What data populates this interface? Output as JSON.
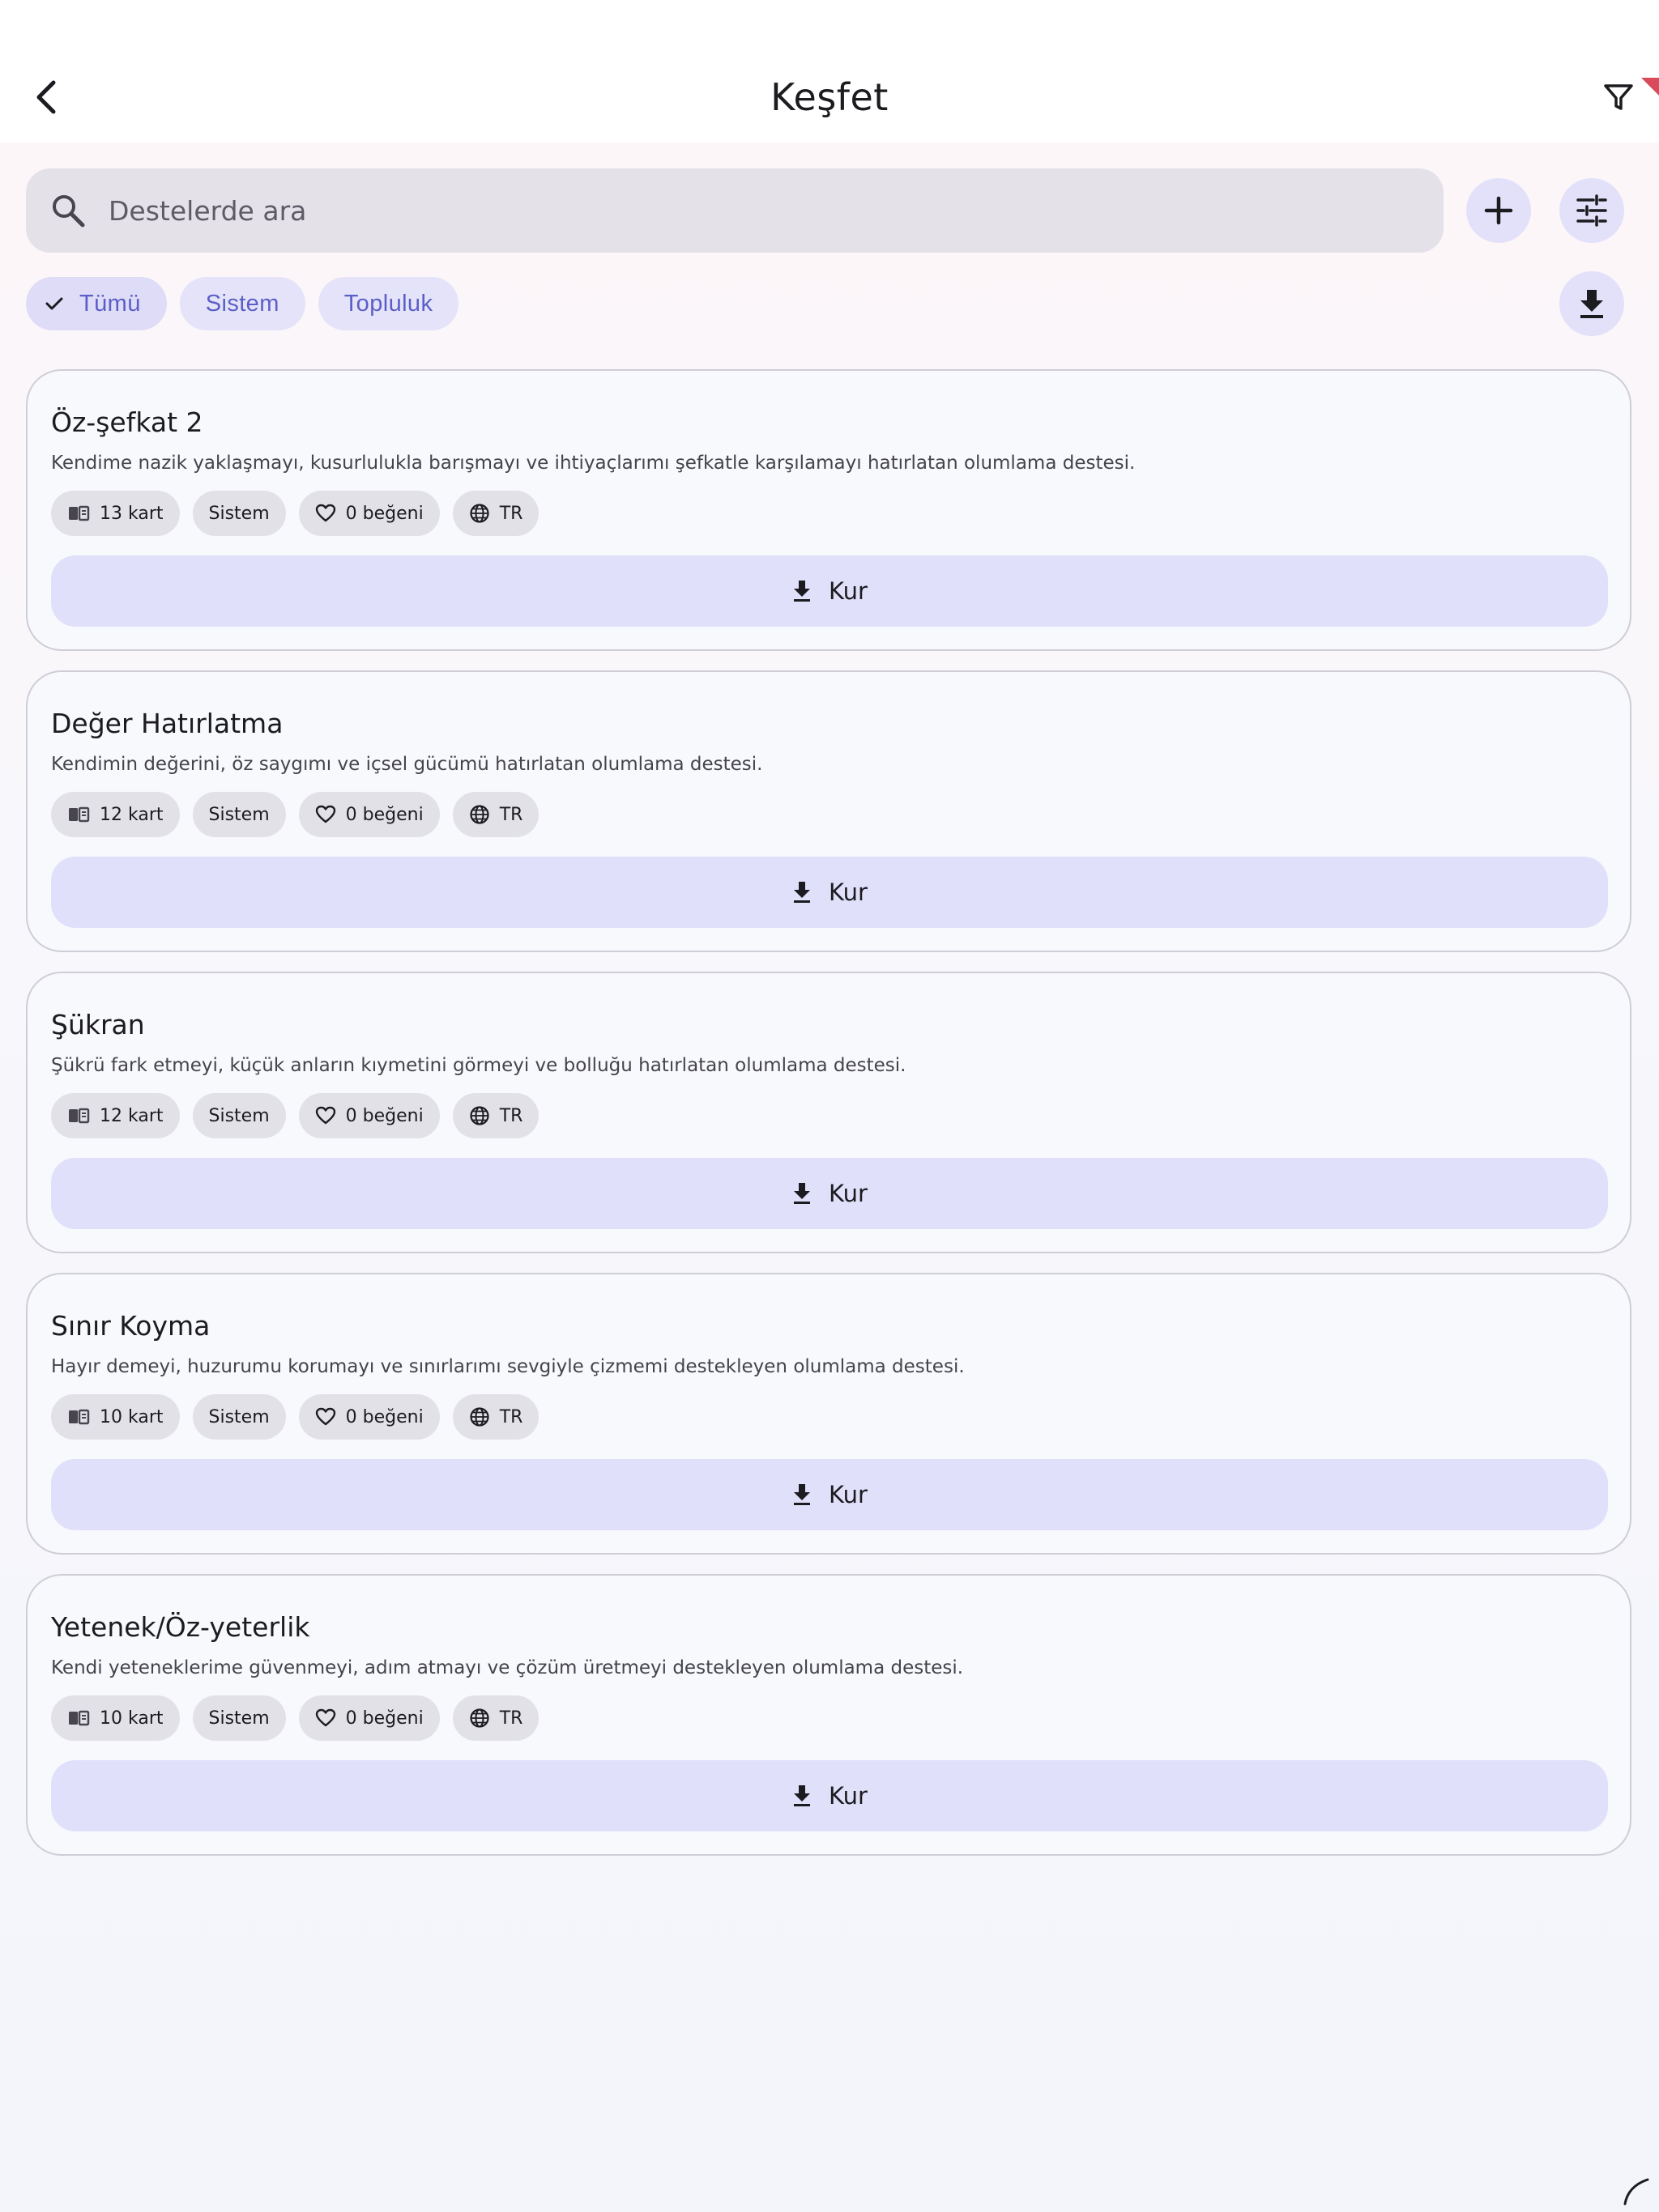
{
  "header": {
    "title": "Keşfet",
    "back_icon": "chevron-left-icon",
    "filter_icon": "filter-funnel-icon"
  },
  "search": {
    "placeholder": "Destelerde ara",
    "value": ""
  },
  "actions": {
    "add_icon": "plus-icon",
    "tune_icon": "sliders-icon",
    "import_icon": "download-icon"
  },
  "filters": [
    {
      "label": "Tümü",
      "selected": true
    },
    {
      "label": "Sistem",
      "selected": false
    },
    {
      "label": "Topluluk",
      "selected": false
    }
  ],
  "decks": [
    {
      "title": "Öz-şefkat 2",
      "description": "Kendime nazik yaklaşmayı, kusurlulukla barışmayı ve ihtiyaçlarımı şefkatle karşılamayı hatırlatan olumlama destesi.",
      "cards": "13 kart",
      "source": "Sistem",
      "likes": "0 beğeni",
      "language": "TR",
      "install_label": "Kur"
    },
    {
      "title": "Değer Hatırlatma",
      "description": "Kendimin değerini, öz saygımı ve içsel gücümü hatırlatan olumlama destesi.",
      "cards": "12 kart",
      "source": "Sistem",
      "likes": "0 beğeni",
      "language": "TR",
      "install_label": "Kur"
    },
    {
      "title": "Şükran",
      "description": "Şükrü fark etmeyi, küçük anların kıymetini görmeyi ve bolluğu hatırlatan olumlama destesi.",
      "cards": "12 kart",
      "source": "Sistem",
      "likes": "0 beğeni",
      "language": "TR",
      "install_label": "Kur"
    },
    {
      "title": "Sınır Koyma",
      "description": "Hayır demeyi, huzurumu korumayı ve sınırlarımı sevgiyle çizmemi destekleyen olumlama destesi.",
      "cards": "10 kart",
      "source": "Sistem",
      "likes": "0 beğeni",
      "language": "TR",
      "install_label": "Kur"
    },
    {
      "title": "Yetenek/Öz-yeterlik",
      "description": "Kendi yeteneklerime güvenmeyi, adım atmayı ve çözüm üretmeyi destekleyen olumlama destesi.",
      "cards": "10 kart",
      "source": "Sistem",
      "likes": "0 beğeni",
      "language": "TR",
      "install_label": "Kur"
    }
  ],
  "colors": {
    "accent": "#5b5fc7",
    "chip_bg": "#e4e3f9",
    "button_bg": "#e1e0fb",
    "search_bg": "#e5e1e9",
    "tag_bg": "#e3e1e8"
  }
}
